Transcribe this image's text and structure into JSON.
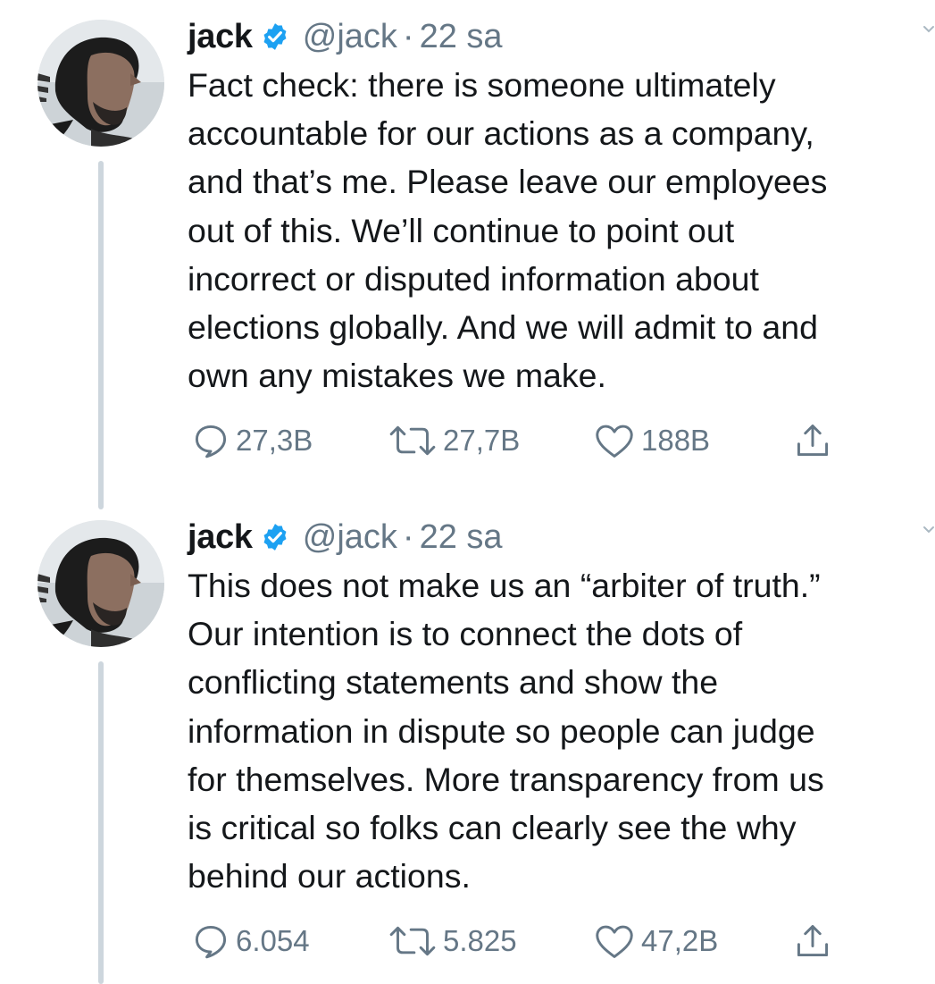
{
  "tweets": [
    {
      "name": "jack",
      "handle": "@jack",
      "separator": "·",
      "time": "22 sa",
      "lines": [
        "Fact check: there is someone ultimately",
        "accountable for our actions as a company,",
        "and that’s me. Please leave our employees",
        "out of this. We’ll continue to point out",
        "incorrect or disputed information about",
        "elections globally. And we will admit to and",
        "own any mistakes we make."
      ],
      "actions": {
        "reply_count": "27,3B",
        "retweet_count": "27,7B",
        "like_count": "188B"
      }
    },
    {
      "name": "jack",
      "handle": "@jack",
      "separator": "·",
      "time": "22 sa",
      "lines": [
        "This does not make us an “arbiter of truth.”",
        "Our intention is to connect the dots of",
        "conflicting statements and show the",
        "information in dispute so people can judge",
        "for themselves. More transparency from us",
        "is critical so folks can clearly see the why",
        "behind our actions."
      ],
      "actions": {
        "reply_count": "6.054",
        "retweet_count": "5.825",
        "like_count": "47,2B"
      }
    }
  ],
  "icons": {
    "verified": "verified-badge-icon",
    "reply": "reply-bubble-icon",
    "retweet": "retweet-arrows-icon",
    "like": "heart-outline-icon",
    "share": "share-upload-icon",
    "more": "chevron-down-icon"
  },
  "colors": {
    "text": "#14171a",
    "secondary": "#657786",
    "verified": "#1da1f2",
    "thread_line": "#cdd6dd"
  }
}
